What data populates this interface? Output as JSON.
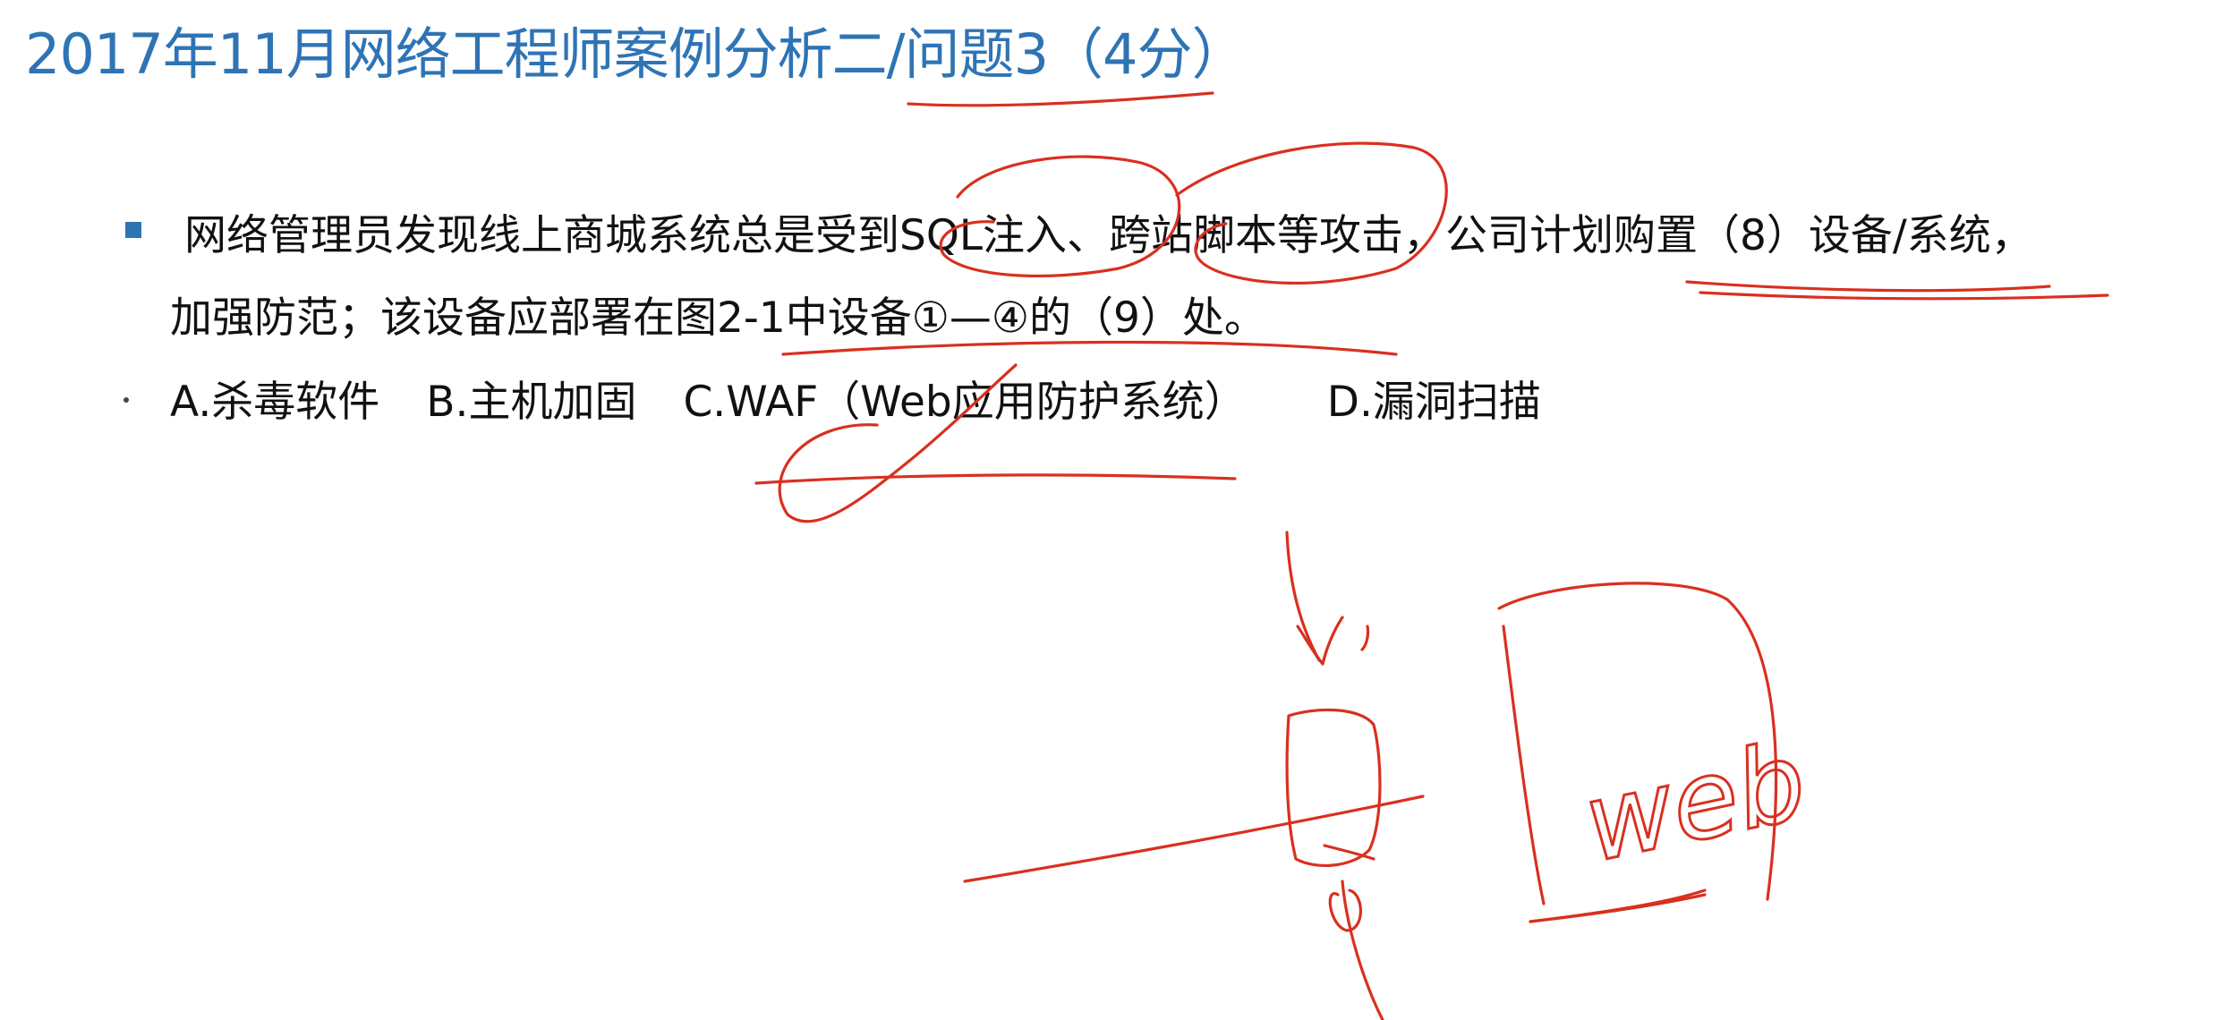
{
  "title": "2017年11月网络工程师案例分析二/问题3（4分）",
  "question": {
    "line1": "网络管理员发现线上商城系统总是受到SQL注入、跨站脚本等攻击，公司计划购置（8）设备/系统，",
    "line2": "加强防范；该设备应部署在图2-1中设备①—④的（9）处。"
  },
  "options": {
    "a": "A.杀毒软件",
    "b": "B.主机加固",
    "c": "C.WAF（Web应用防护系统）",
    "d": "D.漏洞扫描"
  },
  "annotations": {
    "ink_color": "#d9301f",
    "web_label": "web"
  }
}
